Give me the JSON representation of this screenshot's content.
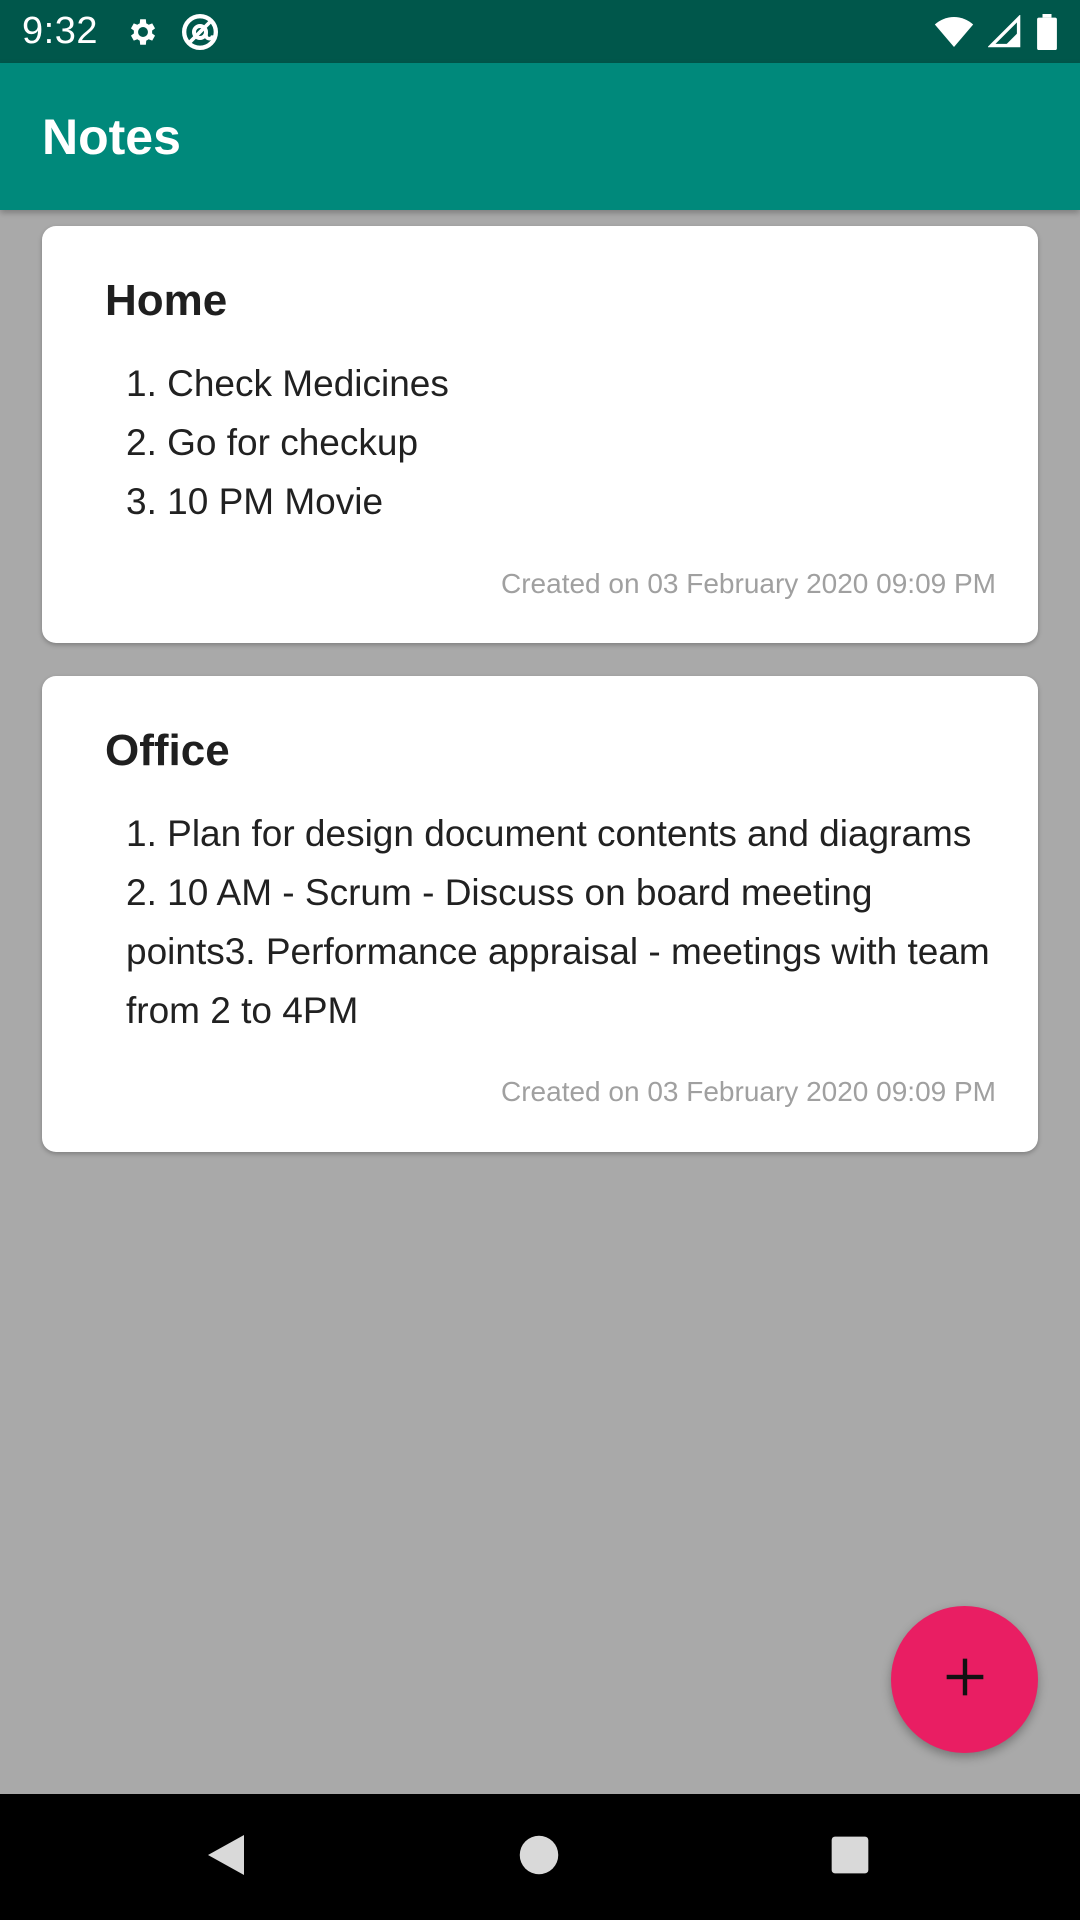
{
  "status_bar": {
    "time": "9:32",
    "left_icons": [
      "gear-icon",
      "at-sign-icon"
    ],
    "right_icons": [
      "wifi-icon",
      "cell-signal-icon",
      "battery-icon"
    ]
  },
  "app_bar": {
    "title": "Notes"
  },
  "notes": [
    {
      "title": "Home",
      "body": "1. Check Medicines\n2. Go for checkup\n3. 10 PM Movie",
      "created": "Created on 03 February 2020 09:09 PM"
    },
    {
      "title": "Office",
      "body": "1. Plan for design document contents and diagrams\n2. 10 AM - Scrum - Discuss on board meeting points3. Performance appraisal - meetings with team from 2 to 4PM",
      "created": "Created on 03 February 2020 09:09 PM"
    }
  ],
  "fab": {
    "icon": "plus-icon"
  },
  "nav_bar": {
    "icons": [
      "back-icon",
      "home-icon",
      "recents-icon"
    ]
  },
  "colors": {
    "status_bar": "#00574b",
    "app_bar": "#00897b",
    "fab": "#e91e63",
    "background": "#a9a9a9"
  }
}
